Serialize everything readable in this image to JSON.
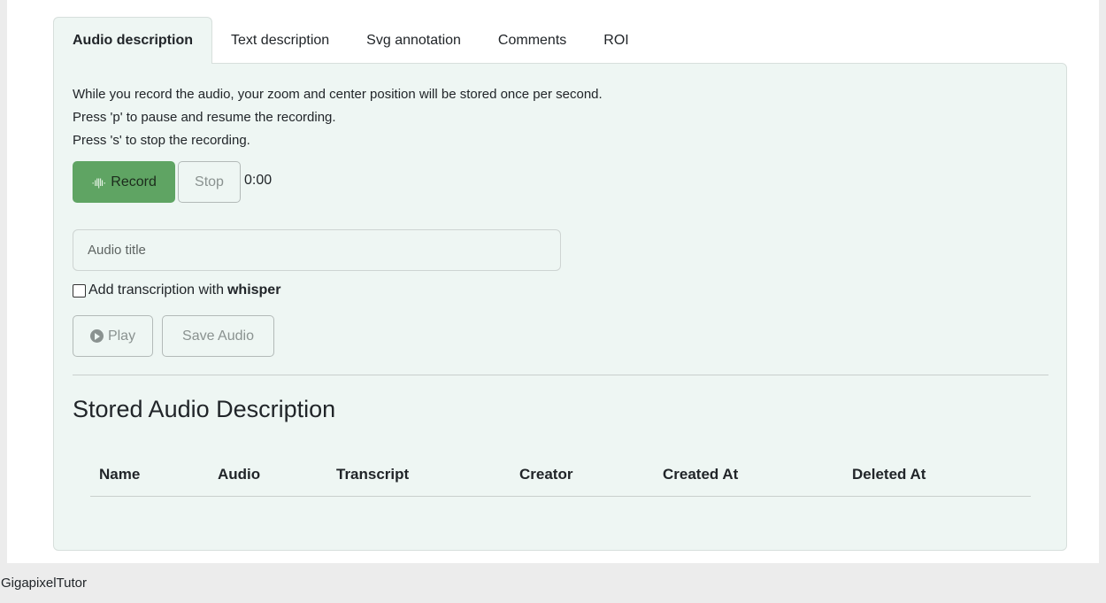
{
  "tabs": [
    {
      "label": "Audio description",
      "active": true
    },
    {
      "label": "Text description",
      "active": false
    },
    {
      "label": "Svg annotation",
      "active": false
    },
    {
      "label": "Comments",
      "active": false
    },
    {
      "label": "ROI",
      "active": false
    }
  ],
  "instructions": {
    "line1": "While you record the audio, your zoom and center position will be stored once per second.",
    "line2": "Press 'p' to pause and resume the recording.",
    "line3": "Press 's' to stop the recording."
  },
  "recorder": {
    "record_icon": "waveform-icon",
    "record_label": "Record",
    "stop_label": "Stop",
    "timer": "0:00",
    "record_color": "#5fa463"
  },
  "form": {
    "title_placeholder": "Audio title",
    "title_value": "",
    "transcription_checked": false,
    "transcription_label": "Add transcription with ",
    "transcription_bold": "whisper",
    "play_icon": "play-circle-icon",
    "play_label": "Play",
    "save_label": "Save Audio"
  },
  "stored": {
    "title": "Stored Audio Description",
    "columns": [
      "Name",
      "Audio",
      "Transcript",
      "Creator",
      "Created At",
      "Deleted At"
    ],
    "rows": []
  },
  "footer": {
    "brand": "GigapixelTutor"
  },
  "colors": {
    "panel_bg": "#eef6f3",
    "page_bg": "#ececec"
  }
}
